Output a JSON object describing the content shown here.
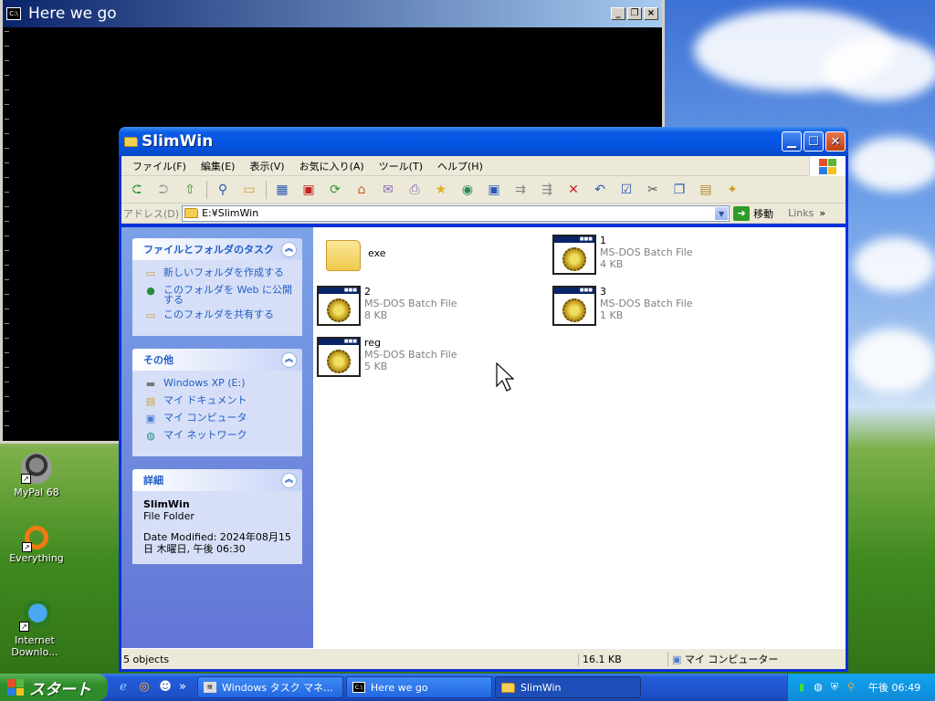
{
  "desktop": {
    "icons": [
      {
        "label": "MyPal 68",
        "icon": "raccoon-icon"
      },
      {
        "label": "Everything",
        "icon": "everything-icon"
      },
      {
        "label": "Internet Downlo...",
        "icon": "idm-icon"
      }
    ]
  },
  "console": {
    "title": "Here we go",
    "icon_text": "C:\\",
    "buttons": {
      "minimize": "_",
      "restore": "ᴘ",
      "close": "×"
    }
  },
  "explorer": {
    "title": "SlimWin",
    "menu": [
      "ファイル(F)",
      "編集(E)",
      "表示(V)",
      "お気に入り(A)",
      "ツール(T)",
      "ヘルプ(H)"
    ],
    "address_label": "アドレス(D)",
    "address_value": "E:¥SlimWin",
    "go_label": "移動",
    "links_label": "Links",
    "tasks_panel": {
      "title": "ファイルとフォルダのタスク",
      "items": [
        "新しいフォルダを作成する",
        "このフォルダを Web に公開する",
        "このフォルダを共有する"
      ]
    },
    "other_panel": {
      "title": "その他",
      "items": [
        "Windows XP (E:)",
        "マイ ドキュメント",
        "マイ コンピュータ",
        "マイ ネットワーク"
      ]
    },
    "details_panel": {
      "title": "詳細",
      "name": "SlimWin",
      "type": "File Folder",
      "modified": "Date Modified: 2024年08月15日 木曜日, 午後 06:30"
    },
    "files": [
      {
        "name": "exe",
        "type": "",
        "size": "",
        "kind": "folder"
      },
      {
        "name": "1",
        "type": "MS-DOS Batch File",
        "size": "4 KB",
        "kind": "batch"
      },
      {
        "name": "2",
        "type": "MS-DOS Batch File",
        "size": "8 KB",
        "kind": "batch"
      },
      {
        "name": "3",
        "type": "MS-DOS Batch File",
        "size": "1 KB",
        "kind": "batch"
      },
      {
        "name": "reg",
        "type": "MS-DOS Batch File",
        "size": "5 KB",
        "kind": "batch"
      }
    ],
    "status": {
      "objects": "5 objects",
      "size": "16.1 KB",
      "location": "マイ コンピューター"
    }
  },
  "taskbar": {
    "start_label": "スタート",
    "quick_launch": [
      "ie-icon",
      "opera-icon",
      "raccoon-icon"
    ],
    "ql_more": "»",
    "buttons": [
      {
        "label": "Windows タスク マネ...",
        "active": false
      },
      {
        "label": "Here we go",
        "active": false
      },
      {
        "label": "SlimWin",
        "active": true
      }
    ],
    "clock": "午後 06:49"
  }
}
